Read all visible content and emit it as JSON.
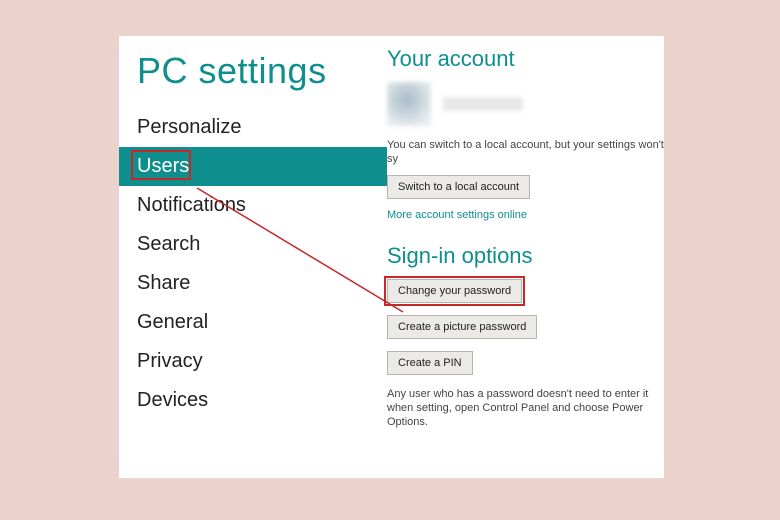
{
  "title": "PC settings",
  "sidebar": {
    "items": [
      {
        "label": "Personalize"
      },
      {
        "label": "Users"
      },
      {
        "label": "Notifications"
      },
      {
        "label": "Search"
      },
      {
        "label": "Share"
      },
      {
        "label": "General"
      },
      {
        "label": "Privacy"
      },
      {
        "label": "Devices"
      }
    ]
  },
  "account": {
    "heading": "Your account",
    "switch_text": "You can switch to a local account, but your settings won't sy",
    "switch_button": "Switch to a local account",
    "more_link": "More account settings online"
  },
  "signin": {
    "heading": "Sign-in options",
    "change_password": "Change your password",
    "picture_password": "Create a picture password",
    "create_pin": "Create a PIN",
    "note": "Any user who has a password doesn't need to enter it when setting, open Control Panel and choose Power Options."
  }
}
